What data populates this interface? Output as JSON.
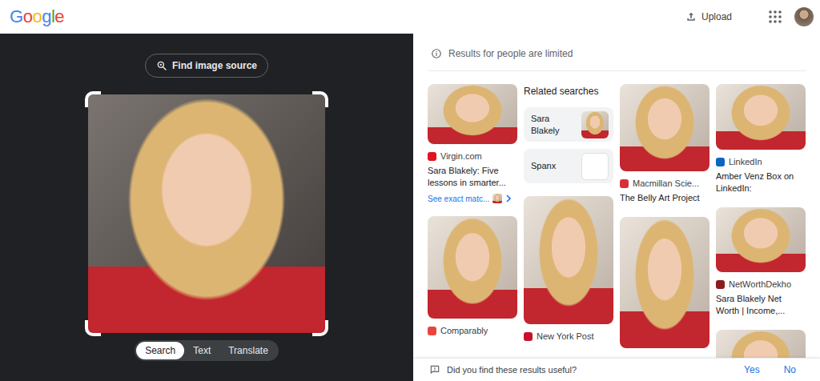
{
  "header": {
    "logo": "Google",
    "upload": "Upload"
  },
  "lens": {
    "find_source": "Find image source",
    "modes": [
      {
        "label": "Search",
        "selected": true
      },
      {
        "label": "Text",
        "selected": false
      },
      {
        "label": "Translate",
        "selected": false
      }
    ]
  },
  "results": {
    "notice": "Results for people are limited",
    "columns": [
      [
        {
          "kind": "result",
          "source": "Virgin.com",
          "color": "#e1141e",
          "title": "Sara Blakely: Five lessons in smarter...",
          "link": "See exact matc..."
        },
        {
          "kind": "result",
          "source": "Comparably",
          "color": "#e8453c"
        }
      ],
      [
        {
          "kind": "related",
          "title": "Related searches",
          "items": [
            {
              "label": "Sara Blakely"
            },
            {
              "label": "Spanx"
            }
          ]
        },
        {
          "kind": "result",
          "source": "New York Post",
          "color": "#c8102e"
        }
      ],
      [
        {
          "kind": "result",
          "source": "Macmillan Scie...",
          "color": "#d6313b",
          "title": "The Belly Art Project"
        },
        {
          "kind": "result"
        }
      ],
      [
        {
          "kind": "result",
          "source": "LinkedIn",
          "color": "#0a66c2",
          "title": "Amber Venz Box on LinkedIn:"
        },
        {
          "kind": "result",
          "source": "NetWorthDekho",
          "color": "#8e1b1b",
          "title": "Sara Blakely Net Worth | Income,..."
        },
        {
          "kind": "result"
        }
      ]
    ]
  },
  "feedback": {
    "question": "Did you find these results useful?",
    "buttons": [
      "Yes",
      "No"
    ]
  }
}
